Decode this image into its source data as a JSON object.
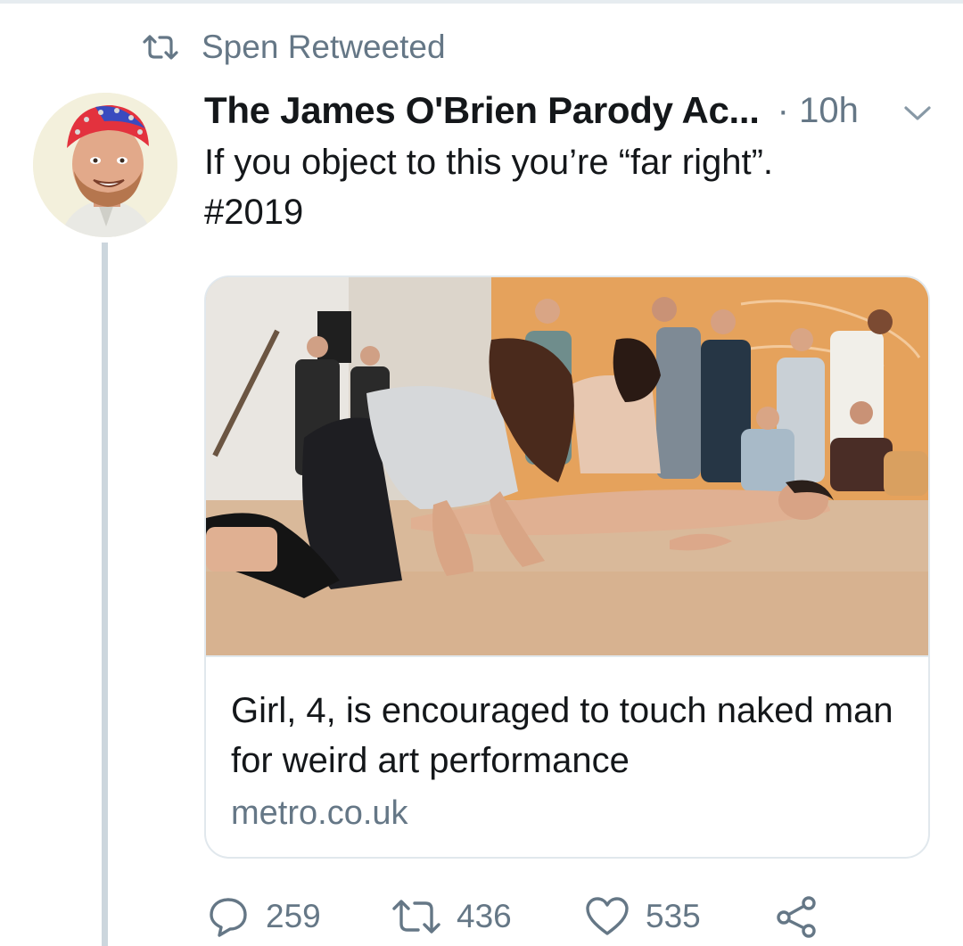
{
  "retweet_context": {
    "icon": "retweet-icon",
    "text": "Spen Retweeted"
  },
  "tweet": {
    "avatar": "avatar",
    "author_name": "The James O'Brien Parody Ac...",
    "time": "· 10h",
    "menu_icon": "chevron-down-icon",
    "text_line1": "If you object to this you’re “far right”.",
    "text_line2": "#2019",
    "card": {
      "image": "article-photo",
      "title": "Girl, 4, is encouraged to touch naked man for weird art performance",
      "domain": "metro.co.uk"
    },
    "actions": {
      "reply_icon": "reply-icon",
      "reply_count": "259",
      "retweet_icon": "retweet-icon",
      "retweet_count": "436",
      "like_icon": "heart-icon",
      "like_count": "535",
      "share_icon": "share-icon"
    }
  },
  "colors": {
    "text_primary": "#14171a",
    "text_secondary": "#657786",
    "border": "#e1e8ed",
    "thread_line": "#ccd6dd"
  }
}
